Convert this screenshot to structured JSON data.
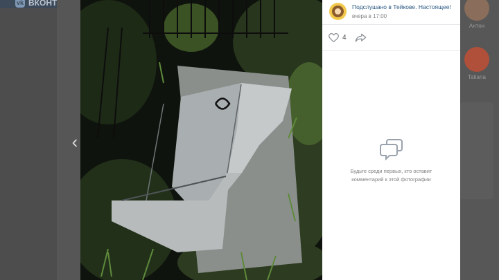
{
  "header": {
    "logo_text": "ВКОНТАКТЕ"
  },
  "background_friends": [
    {
      "name": "Антон"
    },
    {
      "name": "Tatiana"
    }
  ],
  "viewer": {
    "prev_arrow": "‹",
    "next_arrow": "›"
  },
  "post": {
    "group_name": "Подслушано в Тейкове. Настоящее!",
    "time": "вчера в 17:00",
    "likes": "4"
  },
  "comments": {
    "empty_text": "Будьте среди первых, кто оставит комментарий к этой фотографии"
  },
  "colors": {
    "link": "#2a5885",
    "muted": "#828282",
    "icon": "#99a2ad"
  }
}
